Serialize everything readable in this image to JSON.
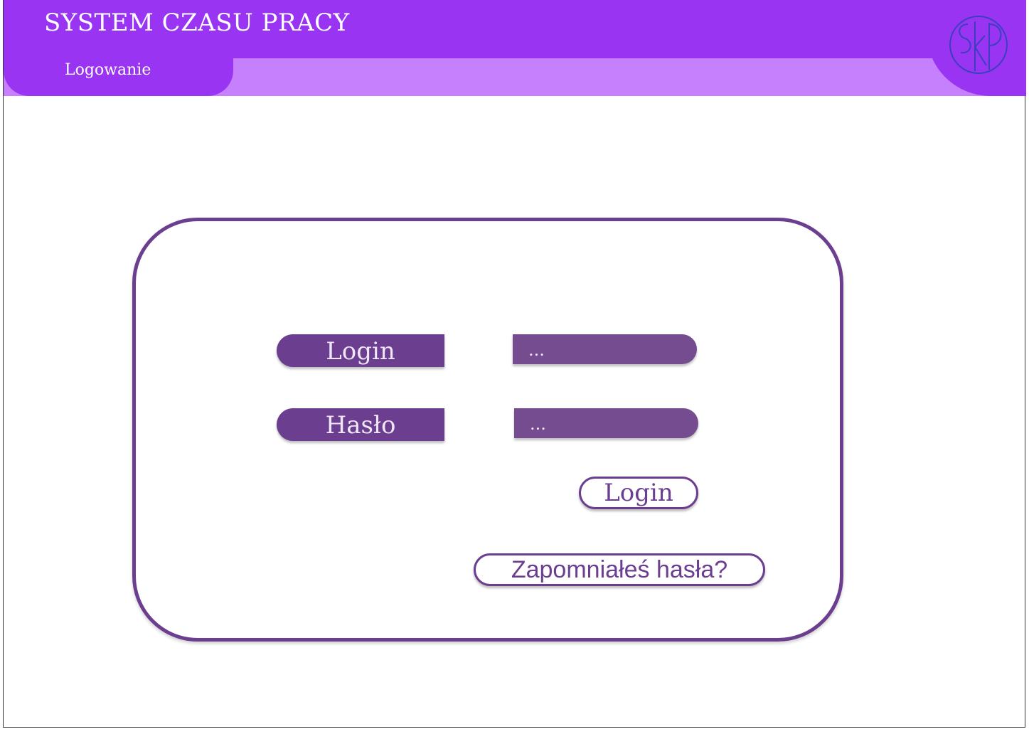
{
  "header": {
    "app_title": "SYSTEM CZASU PRACY",
    "active_tab": "Logowanie",
    "logo_icon": "skp-monogram-logo",
    "colors": {
      "primary": "#9934f2",
      "secondary": "#c680fd",
      "logo_stroke": "#3a3fc0"
    }
  },
  "login_form": {
    "login_label": "Login",
    "login_value": "...",
    "password_label": "Hasło",
    "password_value": "...",
    "submit_label": "Login",
    "forgot_label": "Zapomniałeś hasła?",
    "colors": {
      "accent": "#6b3e8f",
      "input_bg": "#744c8f"
    }
  }
}
